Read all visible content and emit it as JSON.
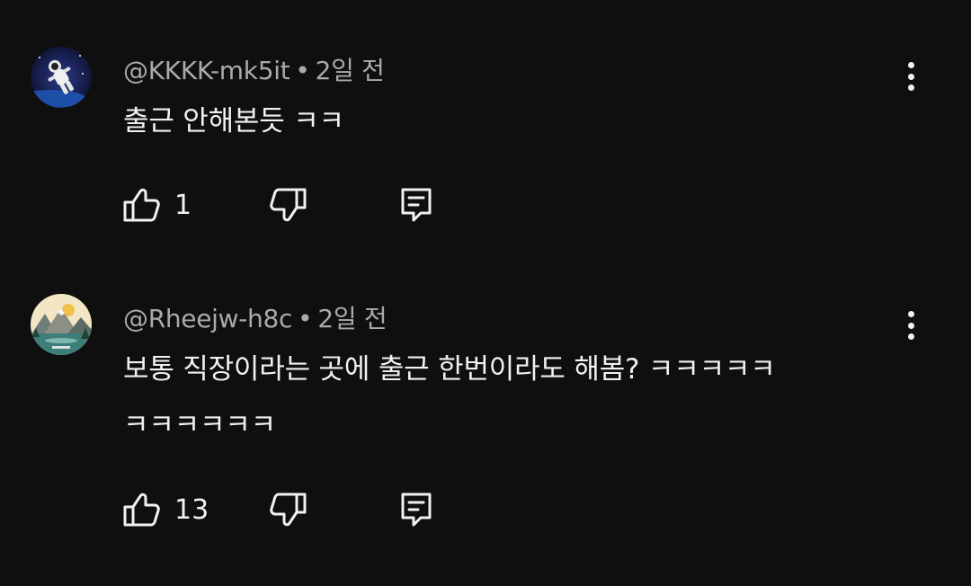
{
  "comments": [
    {
      "handle": "@KKKK-mk5it",
      "separator": "•",
      "time": "2일 전",
      "text": "출근 안해본듯 ㅋㅋ",
      "likes": "1",
      "avatar_icon": "astronaut-icon"
    },
    {
      "handle": "@Rheejw-h8c",
      "separator": "•",
      "time": "2일 전",
      "text": "보통 직장이라는 곳에 출근 한번이라도 해봄? ㅋㅋㅋㅋㅋ ㅋㅋㅋㅋㅋㅋ",
      "likes": "13",
      "avatar_icon": "mountain-landscape-icon"
    }
  ],
  "icons": {
    "like": "thumbs-up-icon",
    "dislike": "thumbs-down-icon",
    "reply": "reply-comment-icon",
    "more": "more-vertical-icon"
  },
  "colors": {
    "background": "#0f0f0f",
    "text": "#f1f1f1",
    "meta": "#aaaaaa"
  }
}
